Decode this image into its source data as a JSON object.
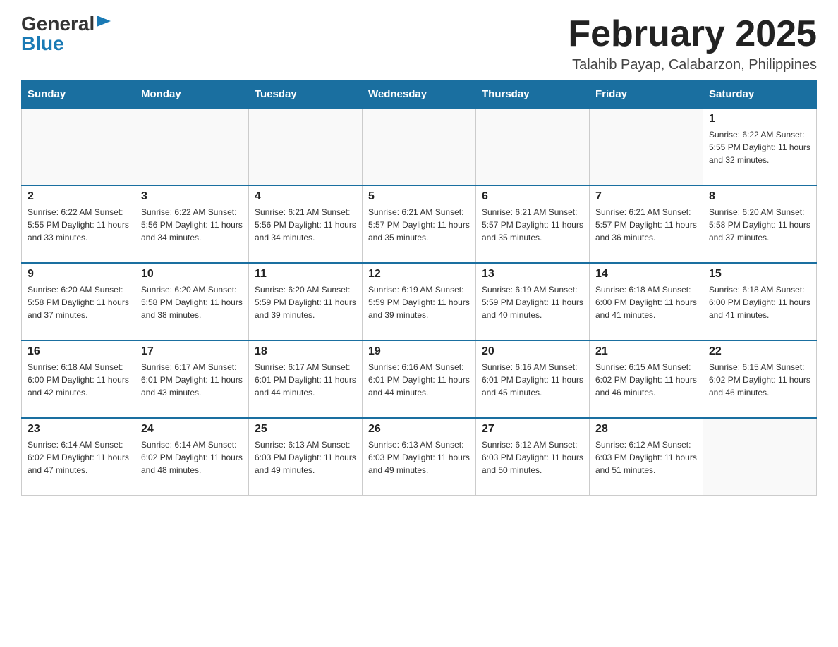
{
  "logo": {
    "general": "General",
    "blue": "Blue"
  },
  "header": {
    "month_year": "February 2025",
    "location": "Talahib Payap, Calabarzon, Philippines"
  },
  "weekdays": [
    "Sunday",
    "Monday",
    "Tuesday",
    "Wednesday",
    "Thursday",
    "Friday",
    "Saturday"
  ],
  "weeks": [
    [
      {
        "day": "",
        "info": ""
      },
      {
        "day": "",
        "info": ""
      },
      {
        "day": "",
        "info": ""
      },
      {
        "day": "",
        "info": ""
      },
      {
        "day": "",
        "info": ""
      },
      {
        "day": "",
        "info": ""
      },
      {
        "day": "1",
        "info": "Sunrise: 6:22 AM\nSunset: 5:55 PM\nDaylight: 11 hours and 32 minutes."
      }
    ],
    [
      {
        "day": "2",
        "info": "Sunrise: 6:22 AM\nSunset: 5:55 PM\nDaylight: 11 hours and 33 minutes."
      },
      {
        "day": "3",
        "info": "Sunrise: 6:22 AM\nSunset: 5:56 PM\nDaylight: 11 hours and 34 minutes."
      },
      {
        "day": "4",
        "info": "Sunrise: 6:21 AM\nSunset: 5:56 PM\nDaylight: 11 hours and 34 minutes."
      },
      {
        "day": "5",
        "info": "Sunrise: 6:21 AM\nSunset: 5:57 PM\nDaylight: 11 hours and 35 minutes."
      },
      {
        "day": "6",
        "info": "Sunrise: 6:21 AM\nSunset: 5:57 PM\nDaylight: 11 hours and 35 minutes."
      },
      {
        "day": "7",
        "info": "Sunrise: 6:21 AM\nSunset: 5:57 PM\nDaylight: 11 hours and 36 minutes."
      },
      {
        "day": "8",
        "info": "Sunrise: 6:20 AM\nSunset: 5:58 PM\nDaylight: 11 hours and 37 minutes."
      }
    ],
    [
      {
        "day": "9",
        "info": "Sunrise: 6:20 AM\nSunset: 5:58 PM\nDaylight: 11 hours and 37 minutes."
      },
      {
        "day": "10",
        "info": "Sunrise: 6:20 AM\nSunset: 5:58 PM\nDaylight: 11 hours and 38 minutes."
      },
      {
        "day": "11",
        "info": "Sunrise: 6:20 AM\nSunset: 5:59 PM\nDaylight: 11 hours and 39 minutes."
      },
      {
        "day": "12",
        "info": "Sunrise: 6:19 AM\nSunset: 5:59 PM\nDaylight: 11 hours and 39 minutes."
      },
      {
        "day": "13",
        "info": "Sunrise: 6:19 AM\nSunset: 5:59 PM\nDaylight: 11 hours and 40 minutes."
      },
      {
        "day": "14",
        "info": "Sunrise: 6:18 AM\nSunset: 6:00 PM\nDaylight: 11 hours and 41 minutes."
      },
      {
        "day": "15",
        "info": "Sunrise: 6:18 AM\nSunset: 6:00 PM\nDaylight: 11 hours and 41 minutes."
      }
    ],
    [
      {
        "day": "16",
        "info": "Sunrise: 6:18 AM\nSunset: 6:00 PM\nDaylight: 11 hours and 42 minutes."
      },
      {
        "day": "17",
        "info": "Sunrise: 6:17 AM\nSunset: 6:01 PM\nDaylight: 11 hours and 43 minutes."
      },
      {
        "day": "18",
        "info": "Sunrise: 6:17 AM\nSunset: 6:01 PM\nDaylight: 11 hours and 44 minutes."
      },
      {
        "day": "19",
        "info": "Sunrise: 6:16 AM\nSunset: 6:01 PM\nDaylight: 11 hours and 44 minutes."
      },
      {
        "day": "20",
        "info": "Sunrise: 6:16 AM\nSunset: 6:01 PM\nDaylight: 11 hours and 45 minutes."
      },
      {
        "day": "21",
        "info": "Sunrise: 6:15 AM\nSunset: 6:02 PM\nDaylight: 11 hours and 46 minutes."
      },
      {
        "day": "22",
        "info": "Sunrise: 6:15 AM\nSunset: 6:02 PM\nDaylight: 11 hours and 46 minutes."
      }
    ],
    [
      {
        "day": "23",
        "info": "Sunrise: 6:14 AM\nSunset: 6:02 PM\nDaylight: 11 hours and 47 minutes."
      },
      {
        "day": "24",
        "info": "Sunrise: 6:14 AM\nSunset: 6:02 PM\nDaylight: 11 hours and 48 minutes."
      },
      {
        "day": "25",
        "info": "Sunrise: 6:13 AM\nSunset: 6:03 PM\nDaylight: 11 hours and 49 minutes."
      },
      {
        "day": "26",
        "info": "Sunrise: 6:13 AM\nSunset: 6:03 PM\nDaylight: 11 hours and 49 minutes."
      },
      {
        "day": "27",
        "info": "Sunrise: 6:12 AM\nSunset: 6:03 PM\nDaylight: 11 hours and 50 minutes."
      },
      {
        "day": "28",
        "info": "Sunrise: 6:12 AM\nSunset: 6:03 PM\nDaylight: 11 hours and 51 minutes."
      },
      {
        "day": "",
        "info": ""
      }
    ]
  ]
}
